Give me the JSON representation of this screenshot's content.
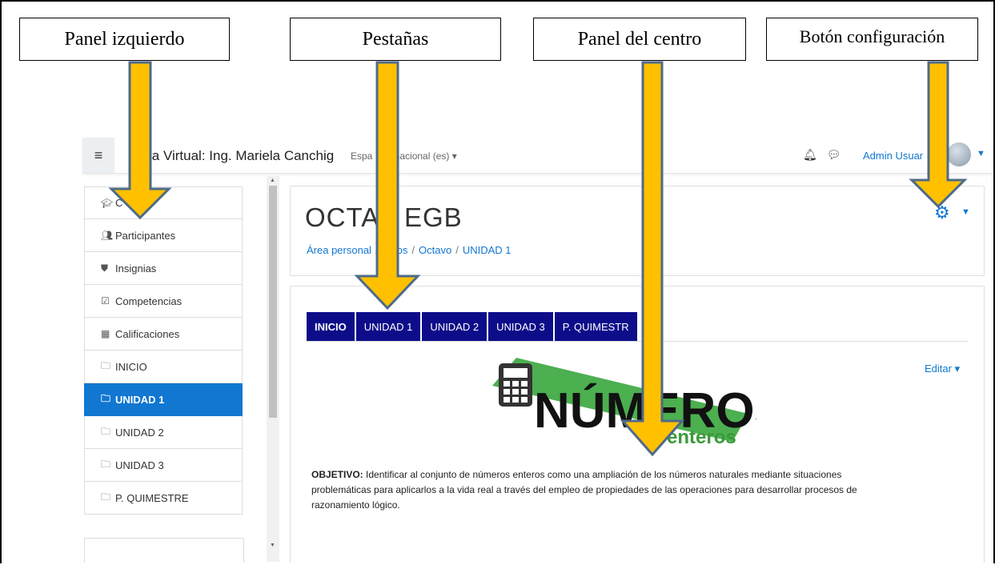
{
  "callouts": {
    "left_panel": "Panel izquierdo",
    "tabs": "Pestañas",
    "center_panel": "Panel del centro",
    "settings_button": "Botón configuración"
  },
  "navbar": {
    "menu_icon": "hamburger-icon",
    "site_title": "la Virtual: Ing. Mariela Canchig",
    "language": "Espa   Internacional (es) ▾",
    "user_name": "Admin Usuar",
    "bell_icon": "bell-icon",
    "chat_icon": "chat-icon"
  },
  "drawer": {
    "items": [
      {
        "label": "C",
        "icon": "graduation-cap-icon"
      },
      {
        "label": "Participantes",
        "icon": "users-icon"
      },
      {
        "label": "Insignias",
        "icon": "shield-icon"
      },
      {
        "label": "Competencias",
        "icon": "checkbox-icon"
      },
      {
        "label": "Calificaciones",
        "icon": "table-icon"
      },
      {
        "label": "INICIO",
        "icon": "folder-icon"
      },
      {
        "label": "UNIDAD 1",
        "icon": "folder-icon",
        "active": true
      },
      {
        "label": "UNIDAD 2",
        "icon": "folder-icon"
      },
      {
        "label": "UNIDAD 3",
        "icon": "folder-icon"
      },
      {
        "label": "P. QUIMESTRE",
        "icon": "folder-icon"
      }
    ]
  },
  "header": {
    "course_title": "OCTAV   EGB",
    "breadcrumb": [
      "Área personal",
      "ursos",
      "Octavo",
      "UNIDAD 1"
    ],
    "settings_icon": "gear-icon"
  },
  "content": {
    "tabs": [
      "INICIO",
      "UNIDAD 1",
      "UNIDAD 2",
      "UNIDAD 3",
      "P. QUIMESTR"
    ],
    "edit_label": "Editar ▾",
    "logo": {
      "word": "NÚMEROS",
      "sub": "enteros",
      "icon": "calculator-icon"
    },
    "objective_label": "OBJETIVO:",
    "objective_text": " Identificar al conjunto de números enteros como una ampliación de los números naturales mediante situaciones problemáticas para aplicarlos a la vida real a través del empleo de propiedades de las operaciones para desarrollar procesos de razonamiento lógico."
  },
  "colors": {
    "accent": "#1177d1",
    "tab_bg": "#0d0d8a",
    "arrow_fill": "#ffc000",
    "arrow_stroke": "#4e6a8a"
  }
}
